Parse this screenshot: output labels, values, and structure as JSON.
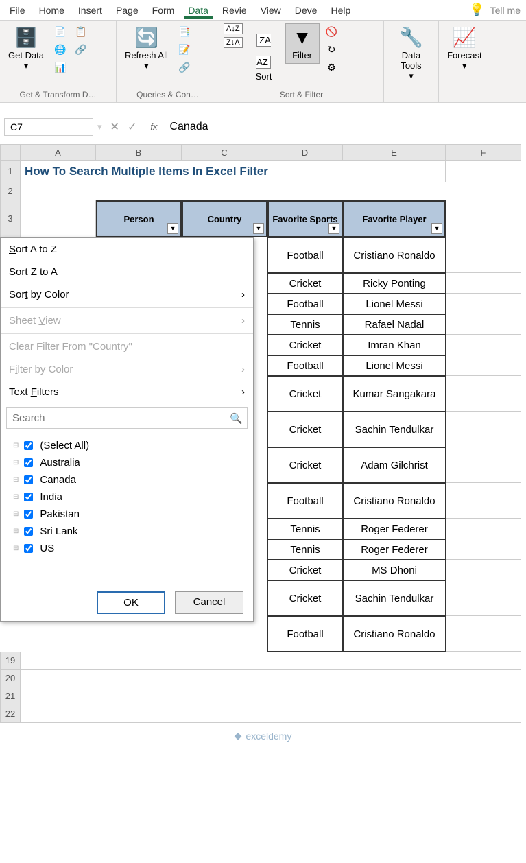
{
  "tabs": [
    "File",
    "Home",
    "Insert",
    "Page",
    "Form",
    "Data",
    "Revie",
    "View",
    "Deve",
    "Help"
  ],
  "active_tab": "Data",
  "tellme": "Tell me",
  "ribbon": {
    "get_data": "Get Data",
    "refresh_all": "Refresh All",
    "sort": "Sort",
    "filter": "Filter",
    "data_tools": "Data Tools",
    "forecast": "Forecast",
    "g1": "Get & Transform D…",
    "g2": "Queries & Con…",
    "g3": "Sort & Filter"
  },
  "namebox": "C7",
  "formula_value": "Canada",
  "columns": [
    "A",
    "B",
    "C",
    "D",
    "E",
    "F"
  ],
  "title": "How To Search Multiple Items In Excel Filter",
  "headers": {
    "person": "Person",
    "country": "Country",
    "sports": "Favorite Sports",
    "player": "Favorite Player"
  },
  "rows_visible": [
    {
      "sports": "Football",
      "player": "Cristiano Ronaldo"
    },
    {
      "sports": "Cricket",
      "player": "Ricky Ponting"
    },
    {
      "sports": "Football",
      "player": "Lionel Messi"
    },
    {
      "sports": "Tennis",
      "player": "Rafael Nadal"
    },
    {
      "sports": "Cricket",
      "player": "Imran Khan"
    },
    {
      "sports": "Football",
      "player": "Lionel Messi"
    },
    {
      "sports": "Cricket",
      "player": "Kumar Sangakara"
    },
    {
      "sports": "Cricket",
      "player": "Sachin Tendulkar"
    },
    {
      "sports": "Cricket",
      "player": "Adam Gilchrist"
    },
    {
      "sports": "Football",
      "player": "Cristiano Ronaldo"
    },
    {
      "sports": "Tennis",
      "player": "Roger Federer"
    },
    {
      "sports": "Tennis",
      "player": "Roger Federer"
    },
    {
      "sports": "Cricket",
      "player": "MS Dhoni"
    },
    {
      "sports": "Cricket",
      "player": "Sachin Tendulkar"
    },
    {
      "sports": "Football",
      "player": "Cristiano Ronaldo"
    }
  ],
  "filter_menu": {
    "sort_az": "Sort A to Z",
    "sort_za": "Sort Z to A",
    "sort_color": "Sort by Color",
    "sheet_view": "Sheet View",
    "clear_filter": "Clear Filter From \"Country\"",
    "filter_color": "Filter by Color",
    "text_filters": "Text Filters",
    "search_ph": "Search",
    "items": [
      "(Select All)",
      "Australia",
      "Canada",
      "India",
      "Pakistan",
      "Sri Lank",
      "US"
    ],
    "ok": "OK",
    "cancel": "Cancel"
  },
  "trailing_rows": [
    "19",
    "20",
    "21",
    "22"
  ],
  "watermark": "exceldemy"
}
